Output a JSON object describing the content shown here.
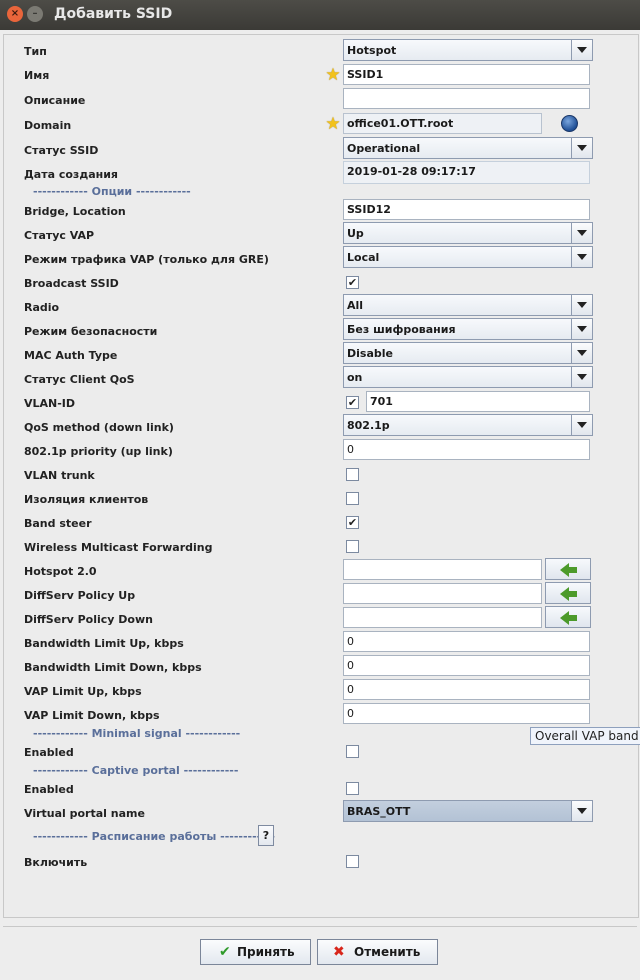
{
  "window": {
    "title": "Добавить SSID"
  },
  "form": {
    "type": {
      "label": "Тип",
      "value": "Hotspot"
    },
    "name": {
      "label": "Имя",
      "value": "SSID1"
    },
    "description": {
      "label": "Описание",
      "value": ""
    },
    "domain": {
      "label": "Domain",
      "value": "office01.OTT.root"
    },
    "ssid_status": {
      "label": "Статус SSID",
      "value": "Operational"
    },
    "created": {
      "label": "Дата создания",
      "value": "2019-01-28 09:17:17"
    },
    "options_sep": "------------ Опции ------------",
    "bridge": {
      "label": "Bridge, Location",
      "value": "SSID12"
    },
    "vap_status": {
      "label": "Статус VAP",
      "value": "Up"
    },
    "vap_mode": {
      "label": "Режим трафика VAP (только для GRE)",
      "value": "Local"
    },
    "broadcast": {
      "label": "Broadcast SSID",
      "checked": "✔"
    },
    "radio": {
      "label": "Radio",
      "value": "All"
    },
    "security": {
      "label": "Режим безопасности",
      "value": "Без шифрования"
    },
    "mac_auth": {
      "label": "MAC Auth Type",
      "value": "Disable"
    },
    "client_qos": {
      "label": "Статус Client QoS",
      "value": "on"
    },
    "vlan": {
      "label": "VLAN-ID",
      "checked": "✔",
      "value": "701"
    },
    "qos_method": {
      "label": "QoS method (down link)",
      "value": "802.1p"
    },
    "priority": {
      "label": "802.1p priority (up link)",
      "value": "0"
    },
    "vlan_trunk": {
      "label": "VLAN trunk",
      "checked": ""
    },
    "isolation": {
      "label": "Изоляция клиентов",
      "checked": ""
    },
    "band_steer": {
      "label": "Band steer",
      "checked": "✔"
    },
    "wmf": {
      "label": "Wireless Multicast Forwarding",
      "checked": ""
    },
    "hotspot20": {
      "label": "Hotspot 2.0",
      "value": ""
    },
    "diffserv_up": {
      "label": "DiffServ Policy Up",
      "value": ""
    },
    "diffserv_down": {
      "label": "DiffServ Policy Down",
      "value": ""
    },
    "bw_up": {
      "label": "Bandwidth Limit Up, kbps",
      "value": "0"
    },
    "bw_down": {
      "label": "Bandwidth Limit Down, kbps",
      "value": "0"
    },
    "vap_up": {
      "label": "VAP Limit Up, kbps",
      "value": "0"
    },
    "vap_down": {
      "label": "VAP Limit Down, kbps",
      "value": "0"
    },
    "tooltip": "Overall VAP band",
    "minsig_sep": "------------ Minimal signal ------------",
    "minsig_enabled": {
      "label": "Enabled",
      "checked": ""
    },
    "captive_sep": "------------ Captive portal ------------",
    "captive_enabled": {
      "label": "Enabled",
      "checked": ""
    },
    "portal_name": {
      "label": "Virtual portal name",
      "value": "BRAS_OTT"
    },
    "schedule_sep": "------------ Расписание работы ------------",
    "help_label": "?",
    "schedule_enable": {
      "label": "Включить",
      "checked": ""
    }
  },
  "buttons": {
    "ok": "Принять",
    "cancel": "Отменить"
  },
  "icons": {
    "star": "star-icon",
    "globe": "globe-icon",
    "arrow": "arrow-left-icon"
  }
}
